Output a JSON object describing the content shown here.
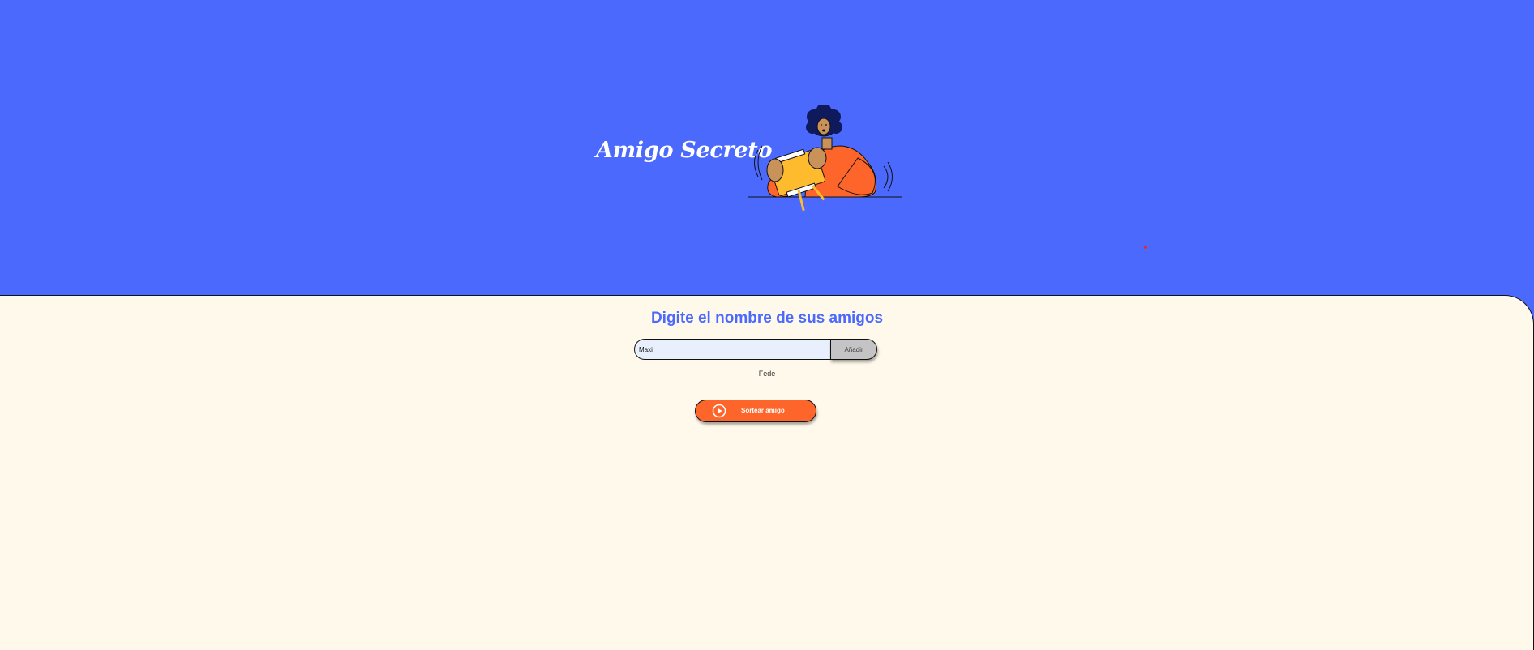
{
  "header": {
    "title": "Amigo Secreto",
    "illustration_icon": "person-holding-gift-illustration"
  },
  "main": {
    "subtitle": "Digite el nombre de sus amigos",
    "name_input": {
      "value": "Maxi",
      "placeholder": ""
    },
    "add_button_label": "Añadir",
    "friends": [
      "Fede"
    ],
    "draw_button": {
      "label": "Sortear amigo",
      "icon": "play-circle-icon"
    }
  },
  "colors": {
    "header_background": "#4b69fd",
    "main_background": "#fff9eb",
    "accent_orange": "#fe652b",
    "input_background": "#e8effd",
    "add_button_background": "#c4c4c4",
    "subtitle_color": "#4b69fd"
  }
}
